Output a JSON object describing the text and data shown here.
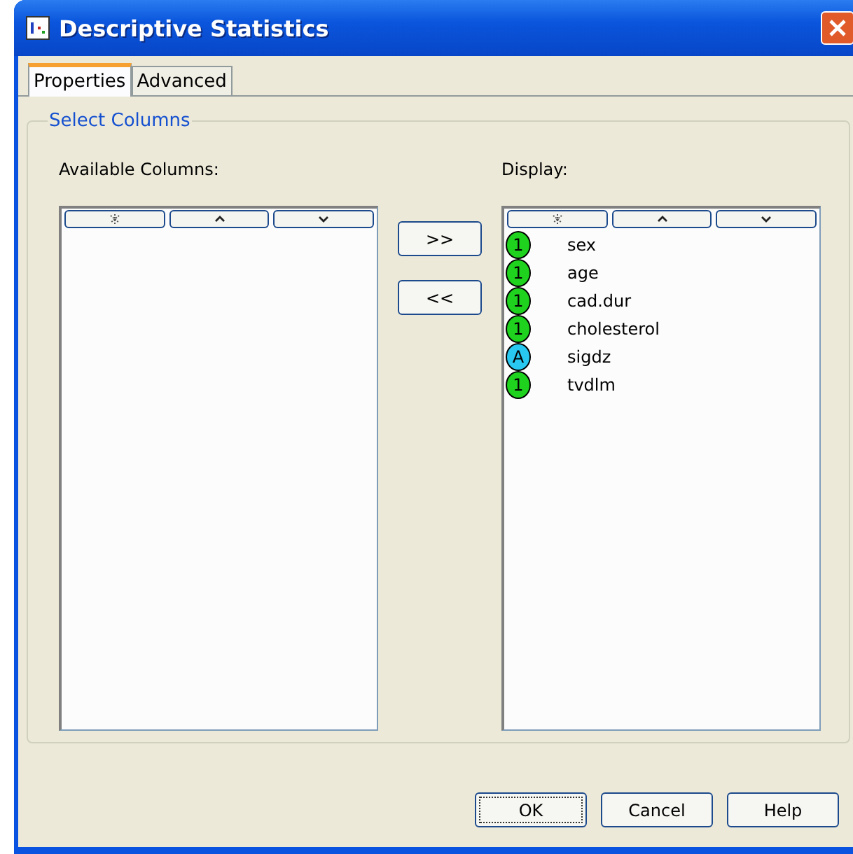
{
  "window": {
    "title": "Descriptive Statistics"
  },
  "tabs": [
    {
      "label": "Properties",
      "selected": true
    },
    {
      "label": "Advanced",
      "selected": false
    }
  ],
  "group": {
    "title": "Select Columns"
  },
  "available": {
    "label": "Available Columns:"
  },
  "move_buttons": [
    ">>",
    "<<"
  ],
  "display": {
    "label": "Display:",
    "items": [
      {
        "name": "sex",
        "kind": "numeric",
        "badge": "1"
      },
      {
        "name": "age",
        "kind": "numeric",
        "badge": "1"
      },
      {
        "name": "cad.dur",
        "kind": "numeric",
        "badge": "1"
      },
      {
        "name": "cholesterol",
        "kind": "numeric",
        "badge": "1"
      },
      {
        "name": "sigdz",
        "kind": "text",
        "badge": "A"
      },
      {
        "name": "tvdlm",
        "kind": "numeric",
        "badge": "1"
      }
    ]
  },
  "buttons": [
    {
      "label": "OK",
      "focused": true
    },
    {
      "label": "Cancel",
      "focused": false
    },
    {
      "label": "Help",
      "focused": false
    }
  ]
}
